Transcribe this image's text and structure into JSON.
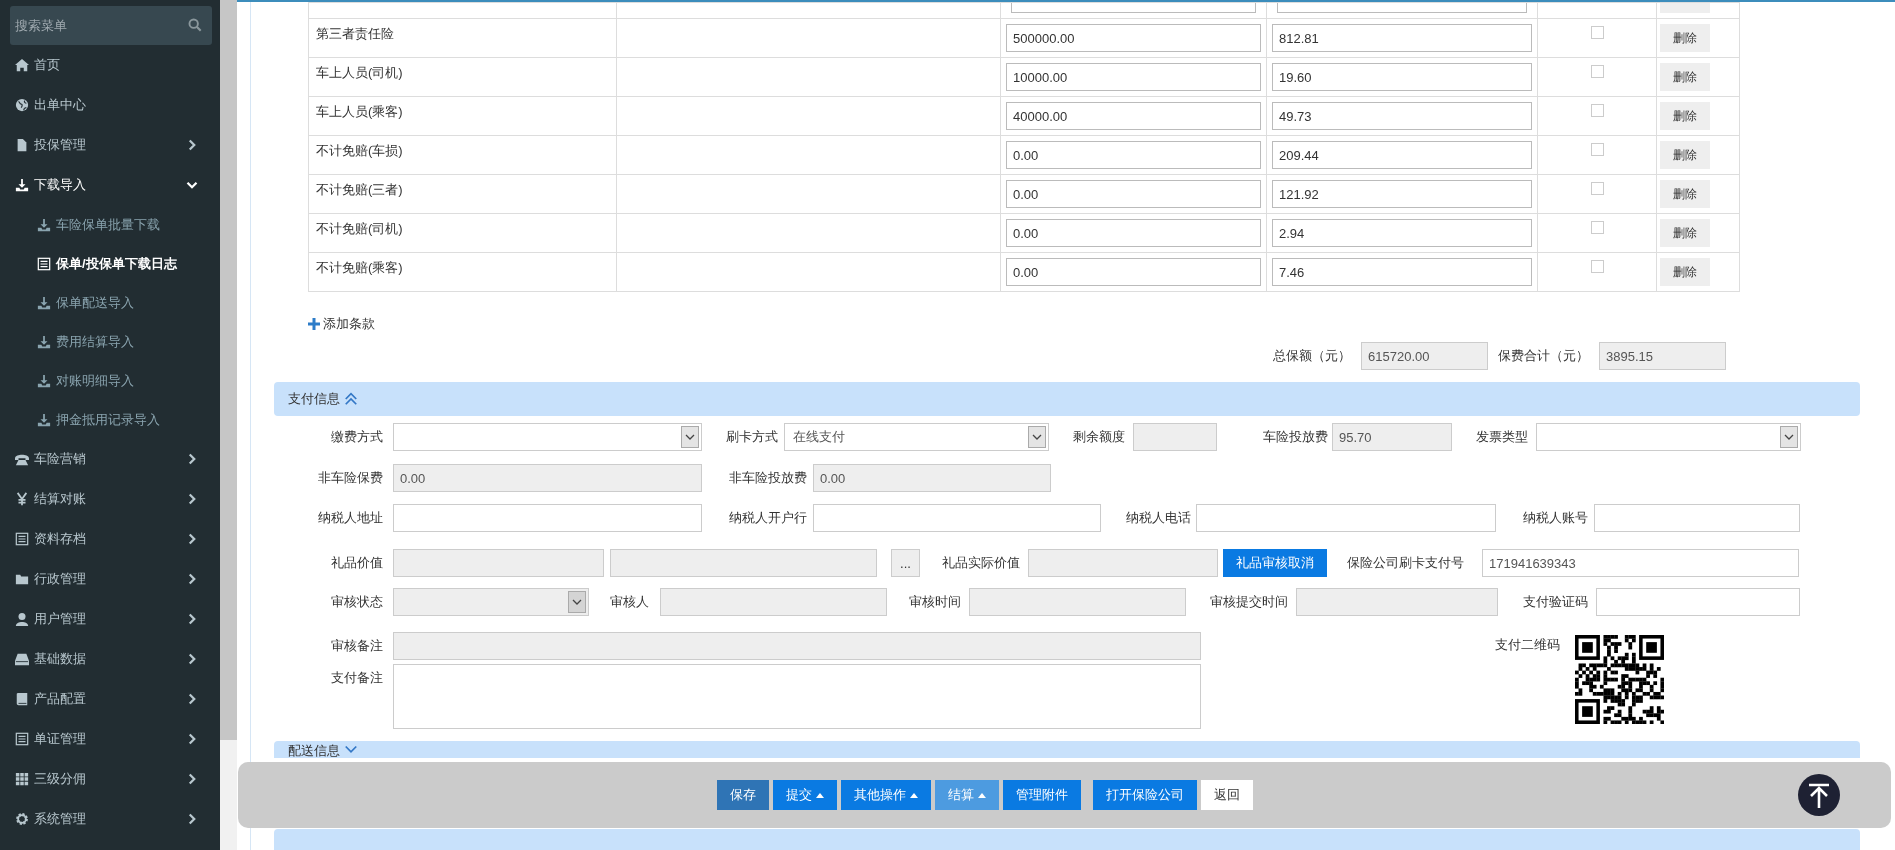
{
  "sidebar": {
    "search": {
      "placeholder": "搜索菜单"
    },
    "items": [
      {
        "label": "首页",
        "kind": "link"
      },
      {
        "label": "出单中心",
        "kind": "link"
      },
      {
        "label": "投保管理",
        "kind": "group",
        "expanded": false
      },
      {
        "label": "下载导入",
        "kind": "group",
        "expanded": true,
        "children": [
          {
            "label": "车险保单批量下载",
            "selected": false
          },
          {
            "label": "保单/投保单下载日志",
            "selected": true
          },
          {
            "label": "保单配送导入",
            "selected": false
          },
          {
            "label": "费用结算导入",
            "selected": false
          },
          {
            "label": "对账明细导入",
            "selected": false
          },
          {
            "label": "押金抵用记录导入",
            "selected": false
          }
        ]
      },
      {
        "label": "车险营销",
        "kind": "group",
        "expanded": false
      },
      {
        "label": "结算对账",
        "kind": "group",
        "expanded": false
      },
      {
        "label": "资料存档",
        "kind": "group",
        "expanded": false
      },
      {
        "label": "行政管理",
        "kind": "group",
        "expanded": false
      },
      {
        "label": "用户管理",
        "kind": "group",
        "expanded": false
      },
      {
        "label": "基础数据",
        "kind": "group",
        "expanded": false
      },
      {
        "label": "产品配置",
        "kind": "group",
        "expanded": false
      },
      {
        "label": "单证管理",
        "kind": "group",
        "expanded": false
      },
      {
        "label": "三级分佣",
        "kind": "group",
        "expanded": false
      },
      {
        "label": "系统管理",
        "kind": "group",
        "expanded": false
      }
    ]
  },
  "table": {
    "rows": [
      {
        "kind": "partial"
      },
      {
        "kind": "item",
        "name": "第三者责任险",
        "amount": "500000.00",
        "premium": "812.81",
        "checked": false,
        "action": "删除"
      },
      {
        "kind": "item",
        "name": "车上人员(司机)",
        "amount": "10000.00",
        "premium": "19.60",
        "checked": false,
        "action": "删除"
      },
      {
        "kind": "item",
        "name": "车上人员(乘客)",
        "amount": "40000.00",
        "premium": "49.73",
        "checked": false,
        "action": "删除"
      },
      {
        "kind": "item",
        "name": "不计免赔(车损)",
        "amount": "0.00",
        "premium": "209.44",
        "checked": false,
        "action": "删除"
      },
      {
        "kind": "item",
        "name": "不计免赔(三者)",
        "amount": "0.00",
        "premium": "121.92",
        "checked": false,
        "action": "删除"
      },
      {
        "kind": "item",
        "name": "不计免赔(司机)",
        "amount": "0.00",
        "premium": "2.94",
        "checked": false,
        "action": "删除"
      },
      {
        "kind": "item",
        "name": "不计免赔(乘客)",
        "amount": "0.00",
        "premium": "7.46",
        "checked": false,
        "action": "删除"
      }
    ],
    "add_link": "添加条款"
  },
  "totals": [
    {
      "label": "总保额（元）",
      "value": "615720.00"
    },
    {
      "label": "保费合计（元）",
      "value": "3895.15"
    }
  ],
  "payment": {
    "title": "支付信息",
    "expanded": true,
    "rows": [
      {
        "fields": [
          {
            "kind": "label",
            "text": "缴费方式"
          },
          {
            "kind": "select",
            "disabled": false
          },
          {
            "kind": "label",
            "text": "刷卡方式"
          },
          {
            "kind": "select",
            "value": "在线支付",
            "disabled": false
          },
          {
            "kind": "label",
            "text": "剩余额度"
          },
          {
            "kind": "input",
            "disabled": true
          },
          {
            "kind": "label",
            "text": "车险投放费"
          },
          {
            "kind": "input",
            "value": "95.70",
            "disabled": true
          },
          {
            "kind": "label",
            "text": "发票类型"
          },
          {
            "kind": "select",
            "disabled": false
          }
        ]
      },
      {
        "fields": [
          {
            "kind": "label",
            "text": "非车险保费"
          },
          {
            "kind": "input",
            "value": "0.00",
            "disabled": true
          },
          {
            "kind": "label",
            "text": "非车险投放费"
          },
          {
            "kind": "input",
            "value": "0.00",
            "disabled": true
          }
        ]
      },
      {
        "fields": [
          {
            "kind": "label",
            "text": "纳税人地址"
          },
          {
            "kind": "input",
            "disabled": false
          },
          {
            "kind": "label",
            "text": "纳税人开户行"
          },
          {
            "kind": "input",
            "disabled": false
          },
          {
            "kind": "label",
            "text": "纳税人电话"
          },
          {
            "kind": "input",
            "disabled": false
          },
          {
            "kind": "label",
            "text": "纳税人账号"
          },
          {
            "kind": "input",
            "disabled": false
          }
        ]
      },
      {
        "fields": [
          {
            "kind": "label",
            "text": "礼品价值"
          },
          {
            "kind": "input",
            "disabled": true
          },
          {
            "kind": "input",
            "disabled": true
          },
          {
            "kind": "browse",
            "text": "..."
          },
          {
            "kind": "label",
            "text": "礼品实际价值"
          },
          {
            "kind": "input",
            "disabled": true
          },
          {
            "kind": "action",
            "text": "礼品审核取消"
          },
          {
            "kind": "label",
            "text": "保险公司刷卡支付号"
          },
          {
            "kind": "input",
            "value": "171941639343",
            "disabled": false
          }
        ]
      },
      {
        "fields": [
          {
            "kind": "label",
            "text": "审核状态"
          },
          {
            "kind": "select",
            "disabled": true
          },
          {
            "kind": "label",
            "text": "审核人"
          },
          {
            "kind": "input",
            "disabled": true
          },
          {
            "kind": "label",
            "text": "审核时间"
          },
          {
            "kind": "input",
            "disabled": true
          },
          {
            "kind": "label",
            "text": "审核提交时间"
          },
          {
            "kind": "input",
            "disabled": true
          },
          {
            "kind": "label",
            "text": "支付验证码"
          },
          {
            "kind": "input",
            "disabled": false
          }
        ]
      },
      {
        "fields": [
          {
            "kind": "label",
            "text": "审核备注"
          },
          {
            "kind": "input",
            "disabled": true
          }
        ]
      },
      {
        "fields": [
          {
            "kind": "label",
            "text": "支付备注"
          },
          {
            "kind": "textarea",
            "disabled": false
          }
        ]
      }
    ],
    "qr_label": "支付二维码"
  },
  "delivery": {
    "title": "配送信息",
    "expanded": false
  },
  "toolbar": {
    "buttons": [
      {
        "label": "保存",
        "kind": "save",
        "caret": false
      },
      {
        "label": "提交",
        "kind": "primary",
        "caret": true
      },
      {
        "label": "其他操作",
        "kind": "primary",
        "caret": true
      },
      {
        "label": "结算",
        "kind": "muted",
        "caret": true
      },
      {
        "label": "管理附件",
        "kind": "primary",
        "caret": false
      },
      {
        "label": "打开保险公司",
        "kind": "primary",
        "caret": false
      },
      {
        "label": "返回",
        "kind": "default",
        "caret": false
      }
    ]
  }
}
